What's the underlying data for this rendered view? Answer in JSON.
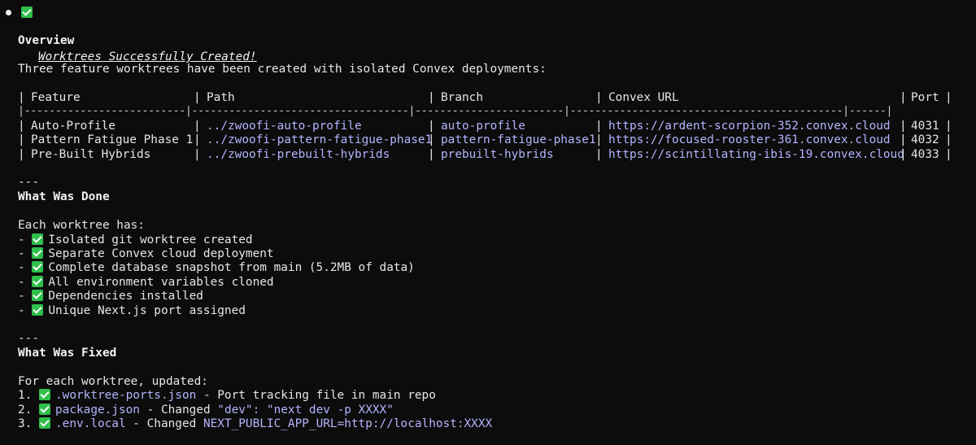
{
  "heading": {
    "bullet": "●",
    "title": "Worktrees Successfully Created!"
  },
  "overview": {
    "heading": "Overview",
    "intro": "Three feature worktrees have been created with isolated Convex deployments:"
  },
  "table": {
    "headers": [
      "Feature",
      "Path",
      "Branch",
      "Convex URL",
      "Port"
    ],
    "separator_row": "|--------------------------|-----------------------------------|------------------------|--------------------------------------------|------|",
    "rows": [
      {
        "feature": "Auto-Profile",
        "path": "../zwoofi-auto-profile",
        "branch": "auto-profile",
        "url": "https://ardent-scorpion-352.convex.cloud",
        "port": "4031"
      },
      {
        "feature": "Pattern Fatigue Phase 1",
        "path": "../zwoofi-pattern-fatigue-phase1",
        "branch": "pattern-fatigue-phase1",
        "url": "https://focused-rooster-361.convex.cloud",
        "port": "4032"
      },
      {
        "feature": "Pre-Built Hybrids",
        "path": "../zwoofi-prebuilt-hybrids",
        "branch": "prebuilt-hybrids",
        "url": "https://scintillating-ibis-19.convex.cloud",
        "port": "4033"
      }
    ]
  },
  "done": {
    "rule": "---",
    "heading": "What Was Done",
    "intro": "Each worktree has:",
    "items": [
      "Isolated git worktree created",
      "Separate Convex cloud deployment",
      "Complete database snapshot from main (5.2MB of data)",
      "All environment variables cloned",
      "Dependencies installed",
      "Unique Next.js port assigned"
    ]
  },
  "fixed": {
    "rule": "---",
    "heading": "What Was Fixed",
    "intro": "For each worktree, updated:",
    "items": [
      {
        "num": "1.",
        "code": ".worktree-ports.json",
        "text": " - Port tracking file in main repo",
        "code2": ""
      },
      {
        "num": "2.",
        "code": "package.json",
        "text": " - Changed ",
        "code2": "\"dev\": \"next dev -p XXXX\""
      },
      {
        "num": "3.",
        "code": ".env.local",
        "text": " - Changed ",
        "code2": "NEXT_PUBLIC_APP_URL=http://localhost:XXXX"
      }
    ]
  }
}
